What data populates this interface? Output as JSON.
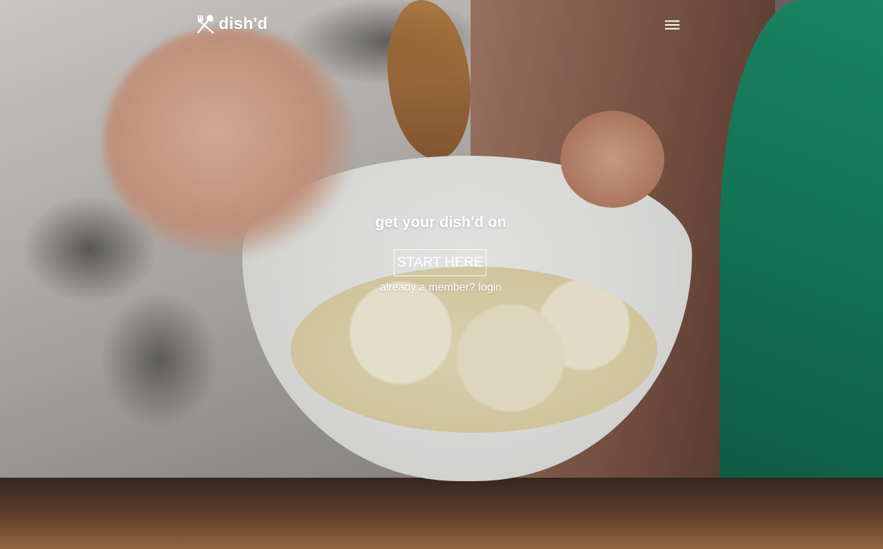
{
  "header": {
    "logo_text": "dish'd",
    "logo_icon": "fork-knife-icon",
    "menu_icon": "hamburger-menu-icon"
  },
  "hero": {
    "tagline": "get your dish'd on",
    "cta_label": "START HERE",
    "login_text": "already a member? login"
  },
  "colors": {
    "text": "#ffffff",
    "button_border": "#ffffff"
  }
}
